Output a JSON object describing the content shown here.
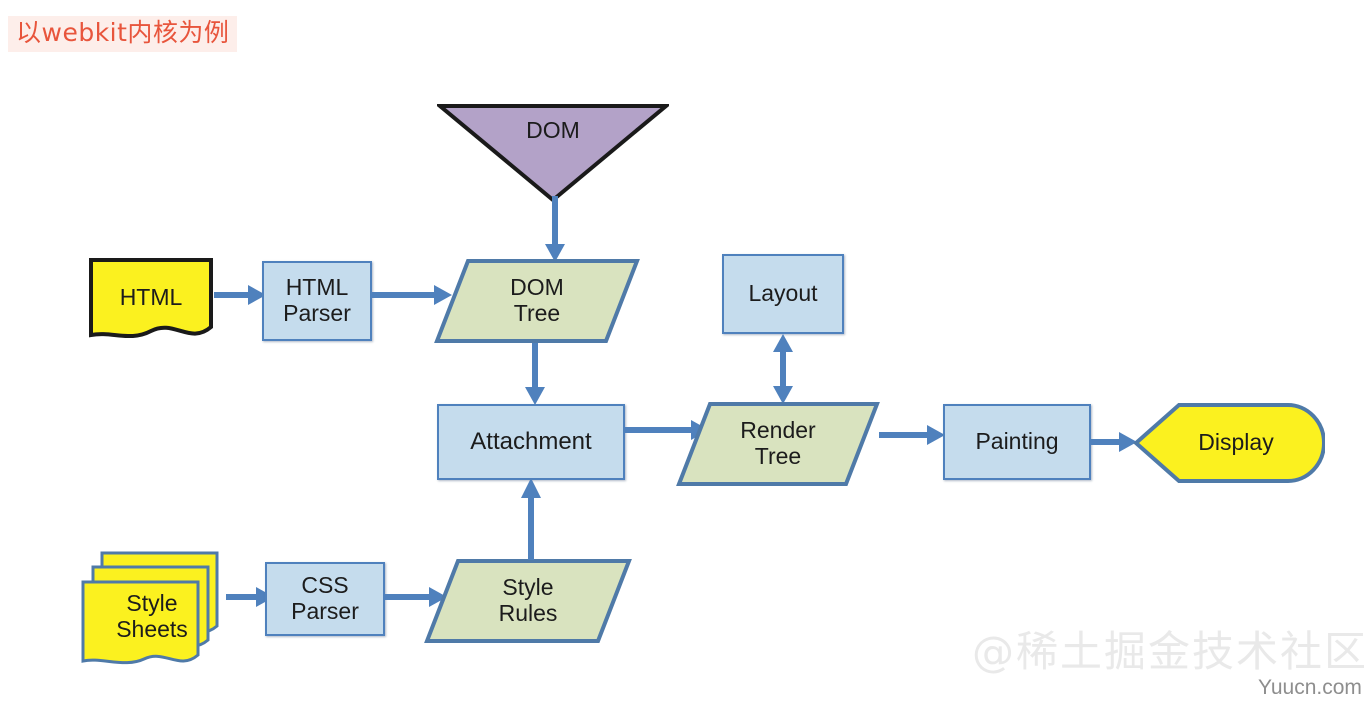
{
  "title": {
    "text": "以webkit内核为例",
    "color": "#e8553c",
    "background": "#fdeeea"
  },
  "palette": {
    "arrow": "#4f81bd",
    "blue_fill": "#c5dced",
    "blue_border": "#4f81bd",
    "green_fill": "#d9e3bf",
    "green_border": "#4f7aa8",
    "yellow_fill": "#fbf11f",
    "yellow_border_black": "#1a1a1a",
    "yellow_border_blue": "#4f7aa8",
    "purple_fill": "#b3a2c8",
    "purple_border": "#1a1a1a"
  },
  "diagram": {
    "type": "flowchart",
    "nodes": [
      {
        "id": "dom",
        "label": "DOM",
        "shape": "inverted-triangle",
        "fill": "#b3a2c8",
        "border": "#1a1a1a"
      },
      {
        "id": "html",
        "label": "HTML",
        "shape": "document",
        "fill": "#fbf11f",
        "border": "#1a1a1a"
      },
      {
        "id": "html-parser",
        "label": "HTML\nParser",
        "shape": "rectangle",
        "fill": "#c5dced",
        "border": "#4f81bd"
      },
      {
        "id": "dom-tree",
        "label": "DOM\nTree",
        "shape": "parallelogram",
        "fill": "#d9e3bf",
        "border": "#4f7aa8"
      },
      {
        "id": "layout",
        "label": "Layout",
        "shape": "rectangle",
        "fill": "#c5dced",
        "border": "#4f81bd"
      },
      {
        "id": "attachment",
        "label": "Attachment",
        "shape": "rectangle",
        "fill": "#c5dced",
        "border": "#4f81bd"
      },
      {
        "id": "render-tree",
        "label": "Render\nTree",
        "shape": "parallelogram",
        "fill": "#d9e3bf",
        "border": "#4f7aa8"
      },
      {
        "id": "painting",
        "label": "Painting",
        "shape": "rectangle",
        "fill": "#c5dced",
        "border": "#4f81bd"
      },
      {
        "id": "display",
        "label": "Display",
        "shape": "flag-pentagon",
        "fill": "#fbf11f",
        "border": "#4f7aa8"
      },
      {
        "id": "stylesheets",
        "label": "Style\nSheets",
        "shape": "multi-document",
        "fill": "#fbf11f",
        "border": "#4f7aa8"
      },
      {
        "id": "css-parser",
        "label": "CSS\nParser",
        "shape": "rectangle",
        "fill": "#c5dced",
        "border": "#4f81bd"
      },
      {
        "id": "style-rules",
        "label": "Style\nRules",
        "shape": "parallelogram",
        "fill": "#d9e3bf",
        "border": "#4f7aa8"
      }
    ],
    "edges": [
      {
        "from": "dom",
        "to": "dom-tree",
        "direction": "down",
        "heads": 1
      },
      {
        "from": "html",
        "to": "html-parser",
        "direction": "right",
        "heads": 1
      },
      {
        "from": "html-parser",
        "to": "dom-tree",
        "direction": "right",
        "heads": 1
      },
      {
        "from": "dom-tree",
        "to": "attachment",
        "direction": "down",
        "heads": 1
      },
      {
        "from": "attachment",
        "to": "render-tree",
        "direction": "right",
        "heads": 1
      },
      {
        "from": "layout",
        "to": "render-tree",
        "direction": "both",
        "heads": 2
      },
      {
        "from": "render-tree",
        "to": "painting",
        "direction": "right",
        "heads": 1
      },
      {
        "from": "painting",
        "to": "display",
        "direction": "right",
        "heads": 1
      },
      {
        "from": "stylesheets",
        "to": "css-parser",
        "direction": "right",
        "heads": 1
      },
      {
        "from": "css-parser",
        "to": "style-rules",
        "direction": "right",
        "heads": 1
      },
      {
        "from": "style-rules",
        "to": "attachment",
        "direction": "up",
        "heads": 1
      }
    ]
  },
  "watermarks": {
    "community": "@稀土掘金技术社区",
    "site": "Yuucn.com"
  }
}
